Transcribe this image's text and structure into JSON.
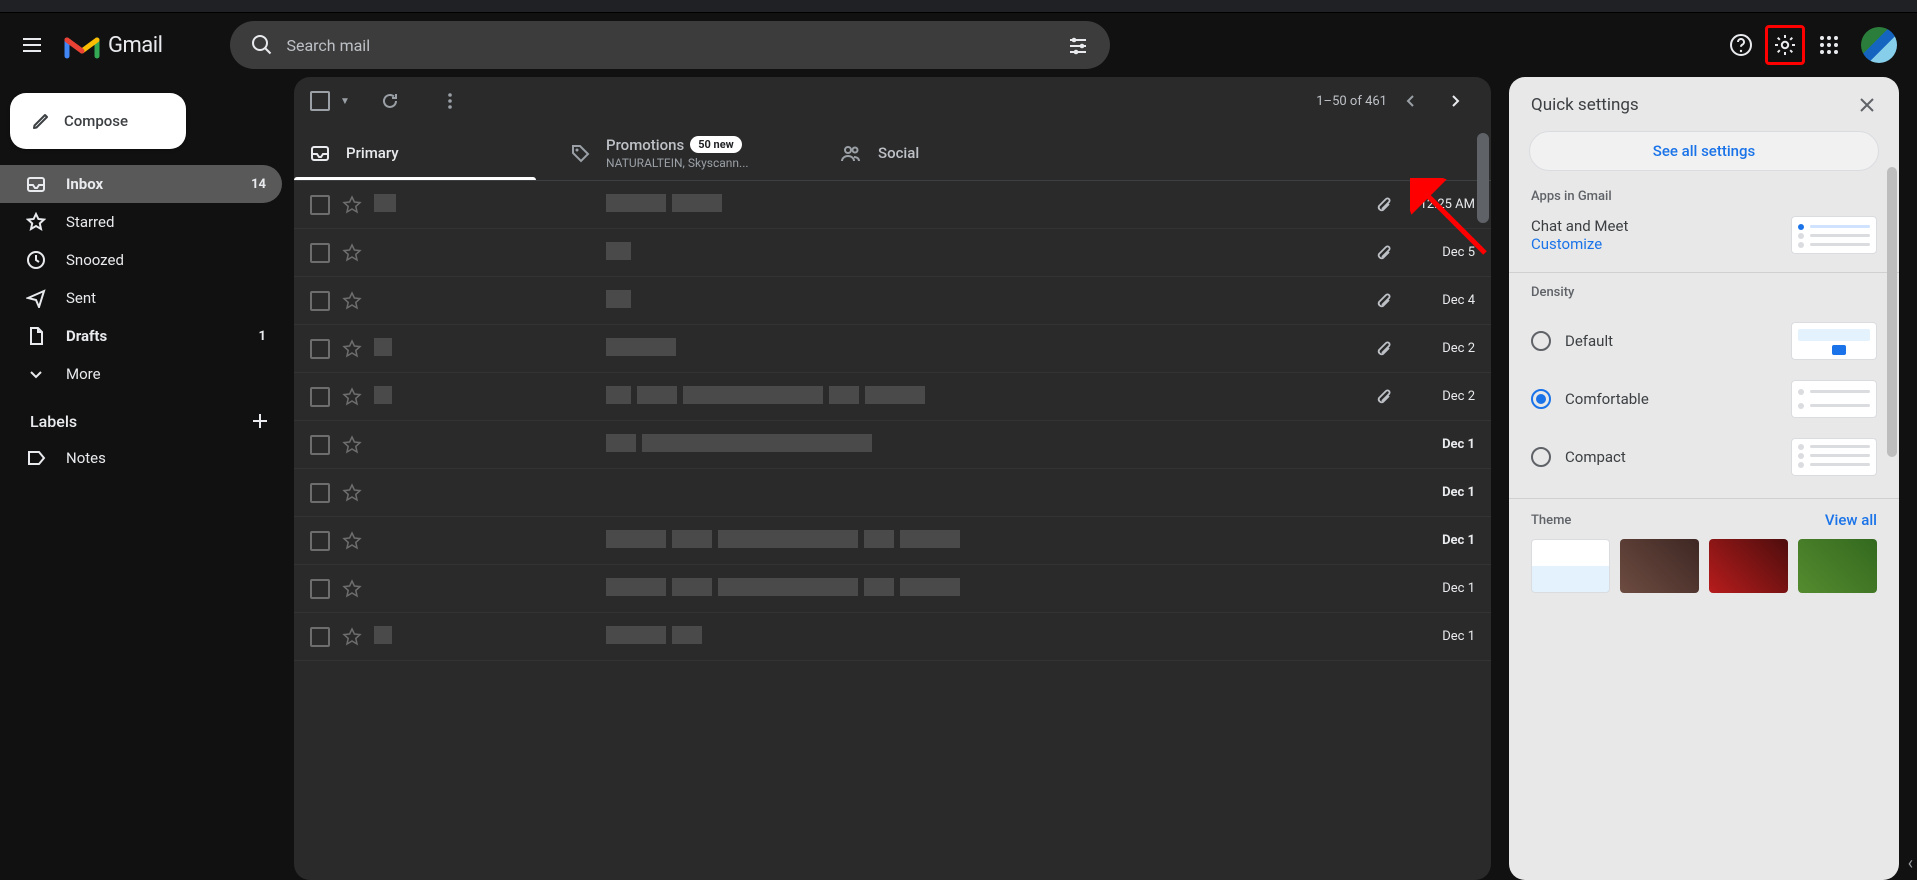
{
  "app": {
    "name": "Gmail"
  },
  "search": {
    "placeholder": "Search mail"
  },
  "compose": {
    "label": "Compose"
  },
  "sidebar": {
    "items": [
      {
        "label": "Inbox",
        "count": "14",
        "active": true,
        "bold": true,
        "icon": "inbox"
      },
      {
        "label": "Starred",
        "icon": "star"
      },
      {
        "label": "Snoozed",
        "icon": "clock"
      },
      {
        "label": "Sent",
        "icon": "send"
      },
      {
        "label": "Drafts",
        "count": "1",
        "bold": true,
        "icon": "file"
      },
      {
        "label": "More",
        "icon": "chevron-down"
      }
    ],
    "labels_header": "Labels",
    "labels": [
      {
        "label": "Notes"
      }
    ]
  },
  "toolbar": {
    "range": "1–50 of 461"
  },
  "tabs": {
    "primary": "Primary",
    "promotions": {
      "label": "Promotions",
      "badge": "50 new",
      "sub": "NATURALTEIN, Skyscann..."
    },
    "social": "Social"
  },
  "rows": [
    {
      "date": "12:25 AM",
      "attach": true,
      "unread": false
    },
    {
      "date": "Dec 5",
      "attach": true,
      "unread": false
    },
    {
      "date": "Dec 4",
      "attach": true,
      "unread": false
    },
    {
      "date": "Dec 2",
      "attach": true,
      "unread": false
    },
    {
      "date": "Dec 2",
      "attach": true,
      "unread": false
    },
    {
      "date": "Dec 1",
      "attach": false,
      "unread": true
    },
    {
      "date": "Dec 1",
      "attach": false,
      "unread": true
    },
    {
      "date": "Dec 1",
      "attach": false,
      "unread": true
    },
    {
      "date": "Dec 1",
      "attach": false,
      "unread": false
    },
    {
      "date": "Dec 1",
      "attach": false,
      "unread": false
    }
  ],
  "quick": {
    "title": "Quick settings",
    "see_all": "See all settings",
    "apps_header": "Apps in Gmail",
    "chat_meet": "Chat and Meet",
    "customize": "Customize",
    "density_header": "Density",
    "density": {
      "default": "Default",
      "comfortable": "Comfortable",
      "compact": "Compact",
      "selected": "comfortable"
    },
    "theme_header": "Theme",
    "view_all": "View all"
  }
}
